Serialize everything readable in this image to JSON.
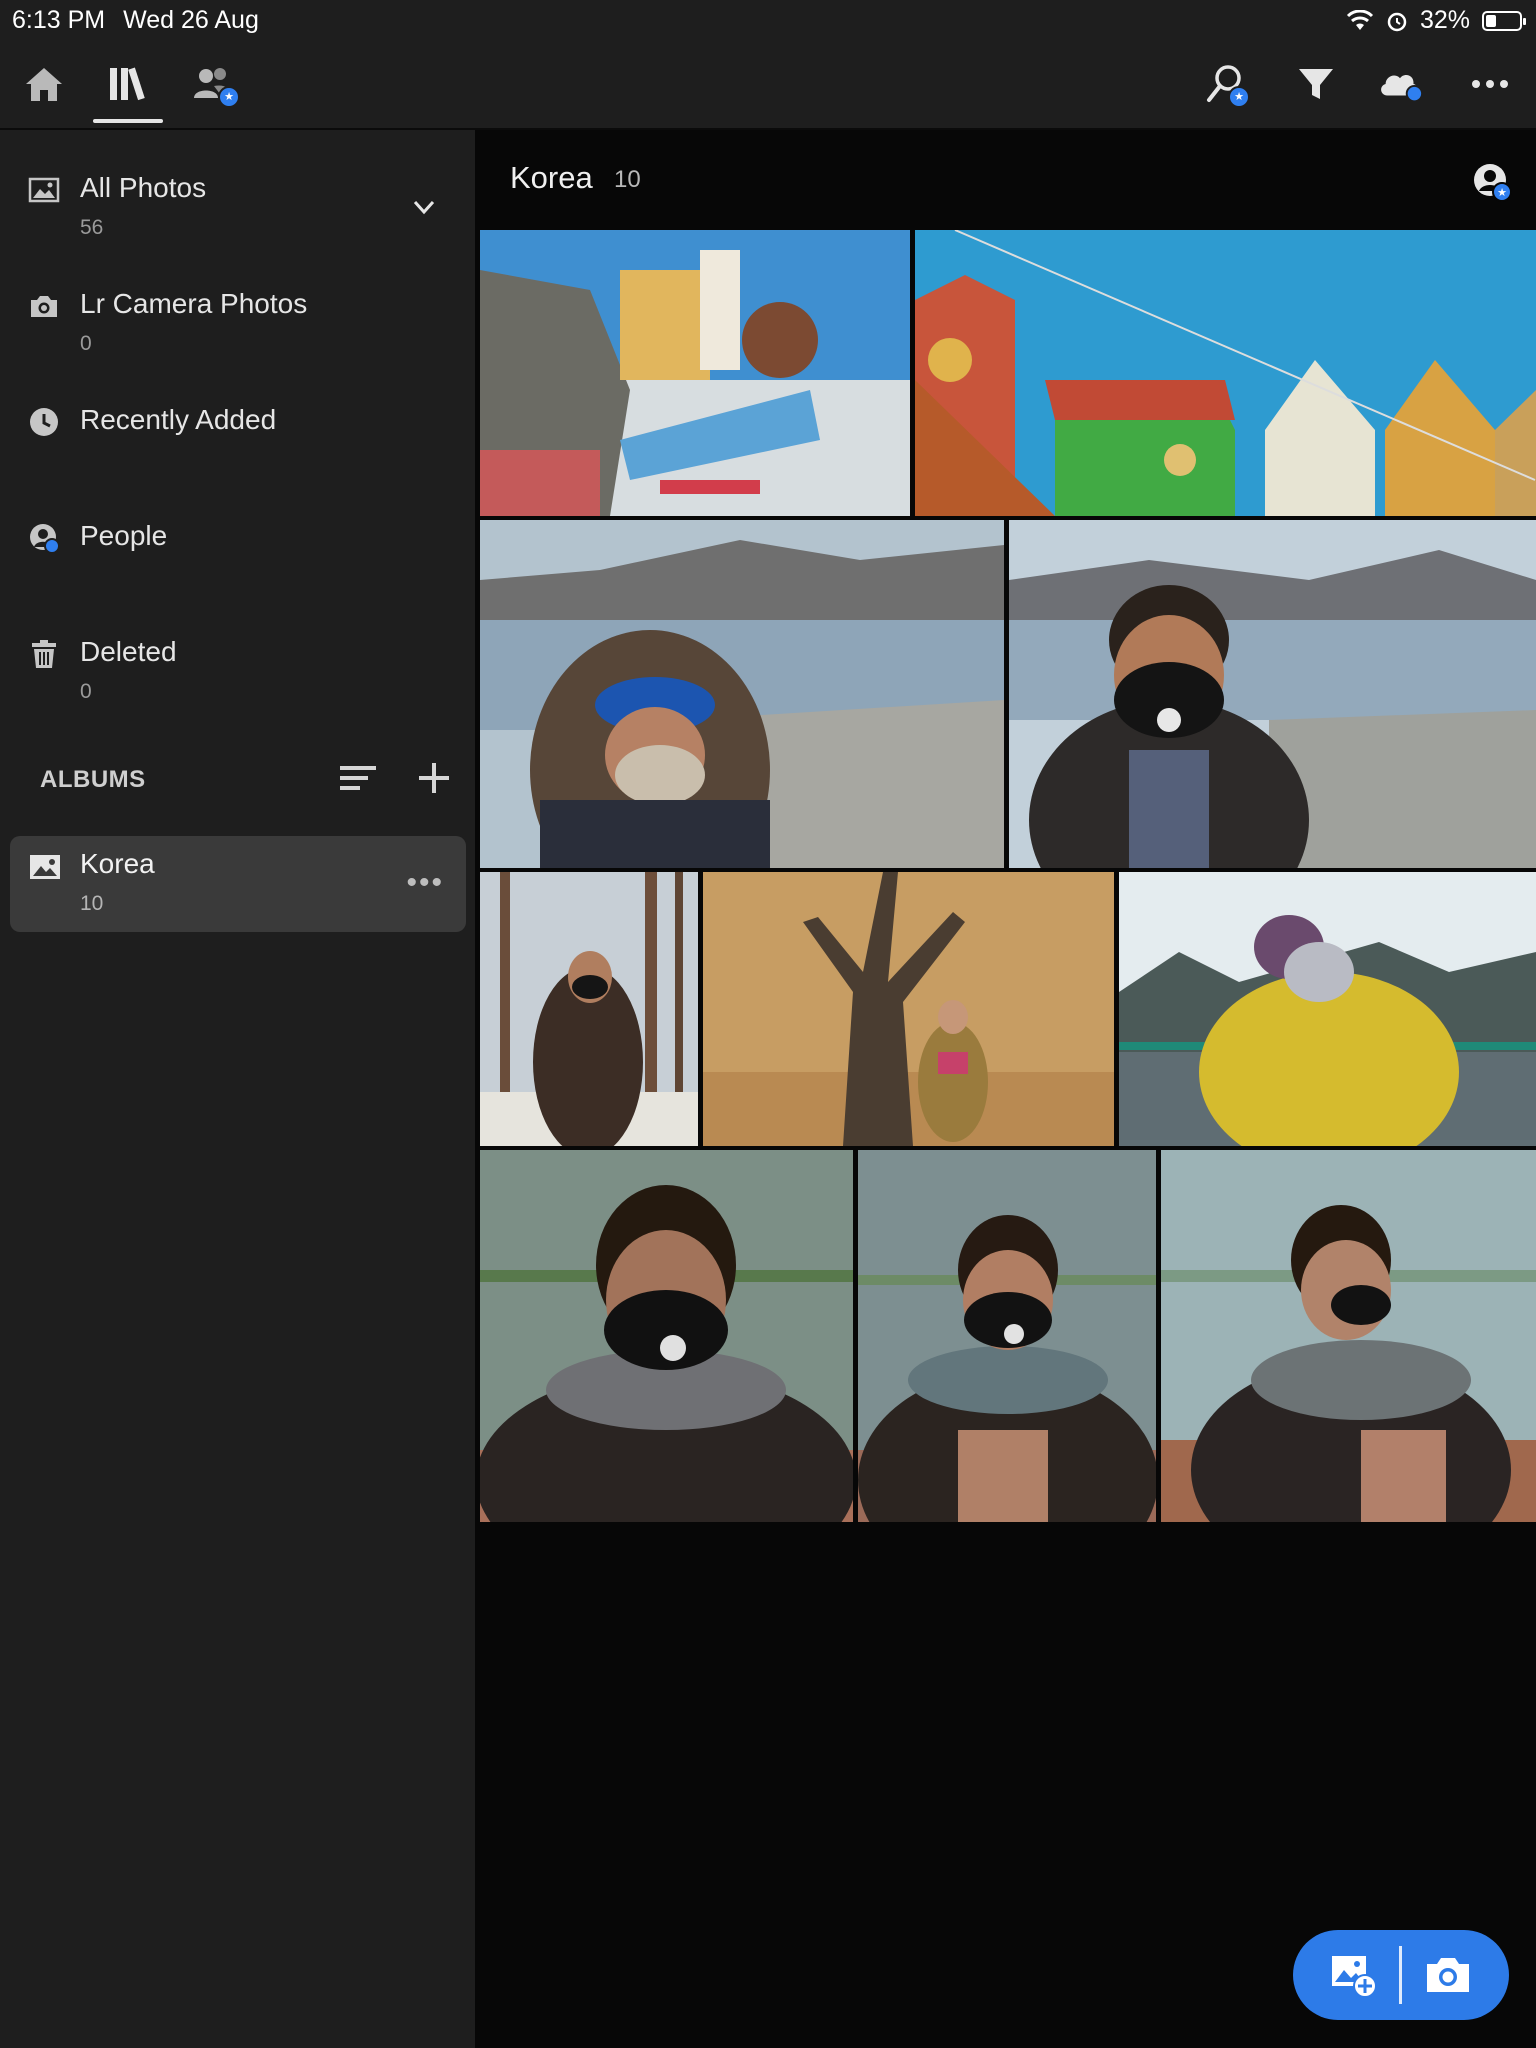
{
  "status_bar": {
    "time": "6:13 PM",
    "date": "Wed 26 Aug",
    "battery_percent": "32%",
    "battery_level": 0.32
  },
  "nav": {
    "left_icons": [
      "home-icon",
      "library-icon",
      "shared-people-icon"
    ],
    "active": "library-icon",
    "right_icons": [
      "search-icon",
      "filter-icon",
      "cloud-sync-icon",
      "more-icon"
    ]
  },
  "sidebar": {
    "items": [
      {
        "label": "All Photos",
        "count": "56",
        "icon": "photos-icon"
      },
      {
        "label": "Lr Camera Photos",
        "count": "0",
        "icon": "camera-icon"
      },
      {
        "label": "Recently Added",
        "icon": "clock-icon"
      },
      {
        "label": "People",
        "icon": "people-icon"
      },
      {
        "label": "Deleted",
        "count": "0",
        "icon": "trash-icon"
      }
    ],
    "albums_header": "ALBUMS",
    "albums": [
      {
        "label": "Korea",
        "count": "10",
        "icon": "album-icon",
        "more": "•••"
      }
    ]
  },
  "main": {
    "title": "Korea",
    "count": "10",
    "photos": [
      {
        "name": "petite-france-sign-photo"
      },
      {
        "name": "colorful-houses-photo"
      },
      {
        "name": "person-blue-hat-lake-photo"
      },
      {
        "name": "man-mask-lake-photo"
      },
      {
        "name": "man-forest-snow-photo"
      },
      {
        "name": "person-tree-autumn-photo"
      },
      {
        "name": "person-yellow-jacket-photo"
      },
      {
        "name": "man-scarf-portrait-1-photo"
      },
      {
        "name": "man-scarf-portrait-2-photo"
      },
      {
        "name": "man-scarf-portrait-3-photo"
      }
    ]
  },
  "fab": {
    "icons": [
      "add-photo-icon",
      "camera-capture-icon"
    ],
    "color": "#2d7be8"
  },
  "colors": {
    "sidebar": "#1e1e1e",
    "main": "#070707",
    "accent": "#2f7ff0",
    "album_selected": "#3a3a3a"
  }
}
